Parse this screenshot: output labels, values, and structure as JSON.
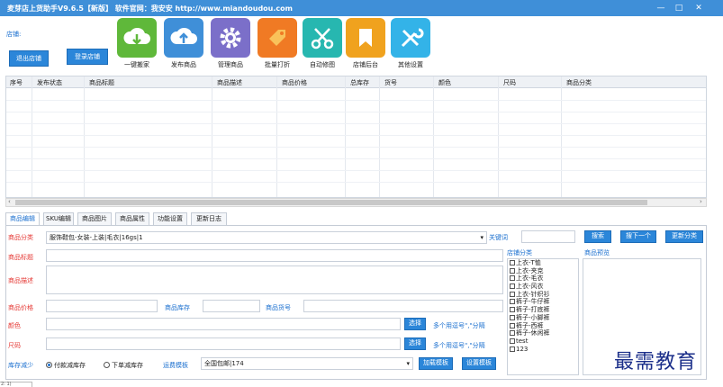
{
  "window": {
    "title": "麦芽店上货助手V9.6.5【新版】  软件官网：我安安 http://www.miandoudou.com",
    "min_symbol": "—",
    "max_symbol": "□",
    "close_symbol": "✕"
  },
  "toolbar": {
    "shop_label": "店铺:",
    "logout_label": "退出店铺",
    "login_label": "登录店铺",
    "tools": [
      {
        "label": "一键搬家",
        "icon": "download-cloud-icon",
        "color": "#5fb83a"
      },
      {
        "label": "发布商品",
        "icon": "upload-cloud-icon",
        "color": "#3f8fd8"
      },
      {
        "label": "管理商品",
        "icon": "gear-icon",
        "color": "#7b6fc9"
      },
      {
        "label": "批量打折",
        "icon": "price-tag-icon",
        "color": "#f07a24"
      },
      {
        "label": "自动修图",
        "icon": "scissors-icon",
        "color": "#27b7b0"
      },
      {
        "label": "店铺后台",
        "icon": "bookmark-icon",
        "color": "#f0a21e"
      },
      {
        "label": "其他设置",
        "icon": "tools-icon",
        "color": "#33b3e8"
      }
    ]
  },
  "table": {
    "columns": [
      "序号",
      "发布状态",
      "商品标题",
      "商品描述",
      "商品价格",
      "总库存",
      "货号",
      "颜色",
      "尺码",
      "商品分类"
    ]
  },
  "scrollbar": {
    "left_arrow": "‹",
    "right_arrow": "›"
  },
  "tabs": [
    "商品编辑",
    "SKU编辑",
    "商品图片",
    "商品属性",
    "功能设置",
    "更新日志"
  ],
  "editor": {
    "category_label": "商品分类",
    "category_value": "服饰鞋包-女装-上装|毛衣|16gs|1",
    "keyword_label": "关键词",
    "keyword_value": "",
    "search_btn": "搜索",
    "next_btn": "搜下一个",
    "update_btn": "更新分类",
    "title_label": "商品标题",
    "desc_label": "商品描述",
    "price_label": "商品价格",
    "stock_label": "商品库存",
    "sku_label": "商品货号",
    "color_label": "颜色",
    "size_label": "尺码",
    "choose_btn": "选择",
    "color_hint": "多个用逗号\",\"分隔",
    "size_hint": "多个用逗号\",\"分隔",
    "stock_reduce_label": "库存减少",
    "radio_pay": "付款减库存",
    "radio_order": "下单减库存",
    "shipping_label": "运费模板",
    "shipping_value": "全国包邮|174",
    "load_template_btn": "加载模板",
    "set_template_btn": "设置模板",
    "shop_cat_label": "店铺分类",
    "preview_label": "商品预览",
    "shop_categories": [
      "上衣-T恤",
      "上衣-夹克",
      "上衣-毛衣",
      "上衣-风衣",
      "上衣-针织衫",
      "裤子-牛仔裤",
      "裤子-打底裤",
      "裤子-小脚裤",
      "裤子-西裤",
      "裤子-休闲裤",
      "test",
      "123"
    ]
  },
  "watermark": "最需教育",
  "status_text": "2: 1)"
}
